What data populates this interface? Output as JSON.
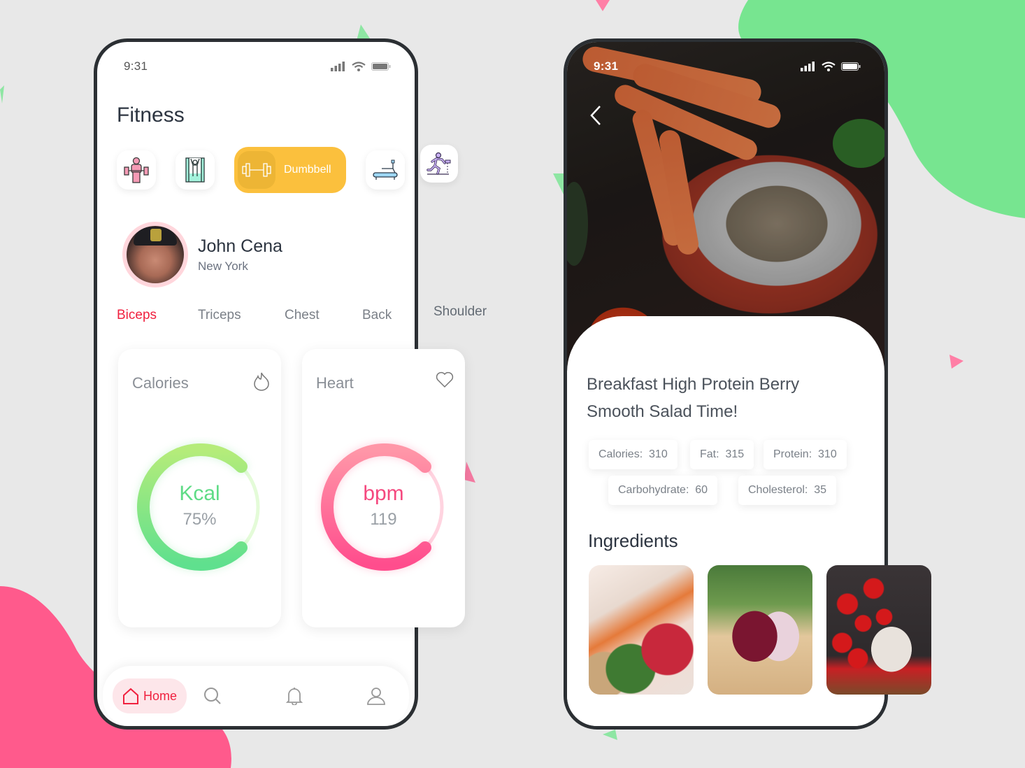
{
  "colors": {
    "background": "#e8e8e8",
    "accent_green": "#77e590",
    "accent_pink": "#ff5a8c",
    "active_yellow": "#fbc03d",
    "active_red": "#f0213f"
  },
  "fitness_screen": {
    "status_bar": {
      "time": "9:31"
    },
    "title": "Fitness",
    "categories": [
      {
        "icon": "weightlifter-icon",
        "label": ""
      },
      {
        "icon": "pullup-bar-icon",
        "label": ""
      },
      {
        "icon": "dumbbell-icon",
        "label": "Dumbbell",
        "active": true
      },
      {
        "icon": "treadmill-icon",
        "label": ""
      },
      {
        "icon": "running-icon",
        "label": ""
      }
    ],
    "profile": {
      "name": "John Cena",
      "city": "New York"
    },
    "muscle_tabs": [
      {
        "label": "Biceps",
        "active": true
      },
      {
        "label": "Triceps"
      },
      {
        "label": "Chest"
      },
      {
        "label": "Back"
      },
      {
        "label": "Shoulder"
      }
    ],
    "cards": {
      "calories": {
        "label": "Calories",
        "unit": "Kcal",
        "value": "75%",
        "progress": 0.75
      },
      "heart": {
        "label": "Heart",
        "unit": "bpm",
        "value": "119",
        "progress": 0.75
      }
    },
    "bottom_nav": {
      "home_label": "Home",
      "items": [
        "home-icon",
        "search-icon",
        "bell-icon",
        "user-icon"
      ]
    }
  },
  "recipe_screen": {
    "status_bar": {
      "time": "9:31"
    },
    "title": "Breakfast High Protein Berry Smooth Salad Time!",
    "nutrition": [
      {
        "label": "Calories:",
        "value": "310"
      },
      {
        "label": "Fat:",
        "value": "315"
      },
      {
        "label": "Protein:",
        "value": "310"
      },
      {
        "label": "Carbohydrate:",
        "value": "60"
      },
      {
        "label": "Cholesterol:",
        "value": "35"
      }
    ],
    "ingredients_title": "Ingredients",
    "ingredients": [
      {
        "name": "vegetables-and-raspberries-photo"
      },
      {
        "name": "red-onion-and-peppercorns-photo"
      },
      {
        "name": "cherry-tomatoes-and-garlic-photo"
      }
    ]
  }
}
